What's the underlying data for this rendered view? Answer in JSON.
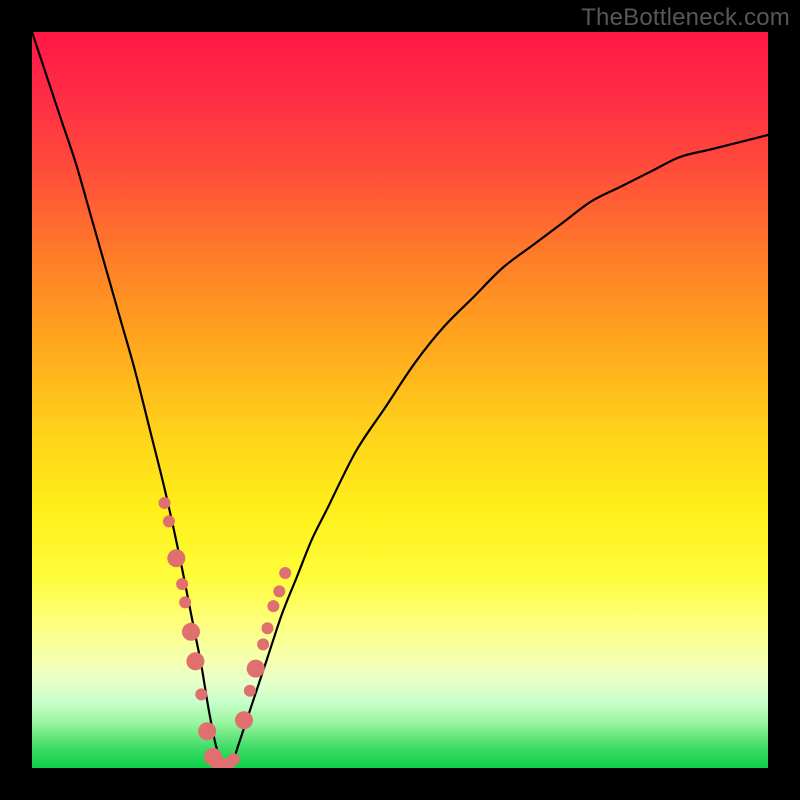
{
  "watermark": "TheBottleneck.com",
  "colors": {
    "frame": "#000000",
    "curve_stroke": "#000000",
    "dot_fill": "#e06f6f",
    "gradient_top": "#ff1846",
    "gradient_bottom": "#0ecf4a"
  },
  "chart_data": {
    "type": "line",
    "title": "",
    "xlabel": "",
    "ylabel": "",
    "xlim": [
      0,
      100
    ],
    "ylim": [
      0,
      100
    ],
    "legend": false,
    "grid": false,
    "annotations": [
      "TheBottleneck.com"
    ],
    "series": [
      {
        "name": "bottleneck-curve",
        "x": [
          0,
          2,
          4,
          6,
          8,
          10,
          12,
          14,
          16,
          18,
          20,
          22,
          23,
          24,
          25,
          26,
          27,
          28,
          30,
          32,
          34,
          36,
          38,
          40,
          44,
          48,
          52,
          56,
          60,
          64,
          68,
          72,
          76,
          80,
          84,
          88,
          92,
          96,
          100
        ],
        "y": [
          100,
          94,
          88,
          82,
          75,
          68,
          61,
          54,
          46,
          38,
          29,
          19,
          14,
          8,
          3,
          0,
          0,
          3,
          9,
          15,
          21,
          26,
          31,
          35,
          43,
          49,
          55,
          60,
          64,
          68,
          71,
          74,
          77,
          79,
          81,
          83,
          84,
          85,
          86
        ]
      }
    ],
    "markers": [
      {
        "name": "highlight-dots",
        "x": [
          18.0,
          18.6,
          19.6,
          20.4,
          20.8,
          21.6,
          22.2,
          23.0,
          23.8,
          24.6,
          25.6,
          26.8,
          27.4,
          28.8,
          29.6,
          30.4,
          31.4,
          32.0,
          32.8,
          33.6,
          34.4
        ],
        "y": [
          36.0,
          33.5,
          28.5,
          25.0,
          22.5,
          18.5,
          14.5,
          10.0,
          5.0,
          1.5,
          0.3,
          0.6,
          1.2,
          6.5,
          10.5,
          13.5,
          16.8,
          19.0,
          22.0,
          24.0,
          26.5
        ],
        "r": [
          6,
          6,
          9,
          6,
          6,
          9,
          9,
          6,
          9,
          9,
          9,
          6,
          6,
          9,
          6,
          9,
          6,
          6,
          6,
          6,
          6
        ]
      }
    ]
  }
}
